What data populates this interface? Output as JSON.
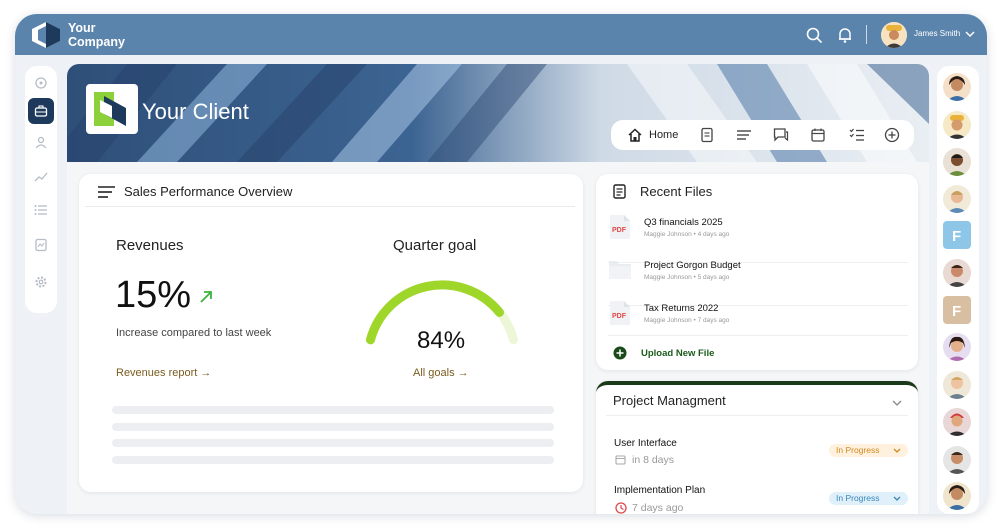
{
  "topbar": {
    "brand_line1": "Your",
    "brand_line2": "Company",
    "user_name": "James Smith",
    "icons": [
      "search-icon",
      "bell-icon",
      "chevron-down-icon"
    ]
  },
  "sidebar": {
    "items": [
      "dashboard-icon",
      "briefcase-icon",
      "user-icon",
      "trend-icon",
      "list-icon",
      "report-icon",
      "gear-icon"
    ],
    "active": "briefcase-icon"
  },
  "hero": {
    "client_name": "Your Client",
    "nav": {
      "home_label": "Home",
      "icons": [
        "home-icon",
        "document-icon",
        "lines-icon",
        "chat-icon",
        "calendar-icon",
        "checklist-icon",
        "plus-circle-icon"
      ]
    }
  },
  "sales": {
    "title": "Sales Performance Overview",
    "revenues_label": "Revenues",
    "revenues_value": "15%",
    "revenues_sub": "Increase compared to last week",
    "revenues_link": "Revenues report →",
    "goal_label": "Quarter goal",
    "goal_value": "84%",
    "goal_fraction": 0.84,
    "goal_link": "All goals →"
  },
  "recent_files": {
    "title": "Recent Files",
    "files": [
      {
        "name": "Q3 financials 2025",
        "meta": "Maggie Johnson • 4 days ago",
        "icon": "pdf-icon"
      },
      {
        "name": "Project Gorgon Budget",
        "meta": "Maggie Johnson • 5 days ago",
        "icon": "folder-icon"
      },
      {
        "name": "Tax Returns 2022",
        "meta": "Maggie Johnson • 7 days ago",
        "icon": "pdf-icon"
      }
    ],
    "upload_label": "Upload New File"
  },
  "project": {
    "title": "Project Managment",
    "tasks": [
      {
        "name": "User Interface",
        "when": "in 8 days",
        "status": "In Progress"
      },
      {
        "name": "Implementation Plan",
        "when": "7 days ago",
        "status": "In Progress"
      }
    ]
  },
  "colors": {
    "topbar": "#5b84ac",
    "active_sidebar": "#1d3a5c",
    "goal_arc": "#9fd62a",
    "link": "#7a5c1e"
  }
}
